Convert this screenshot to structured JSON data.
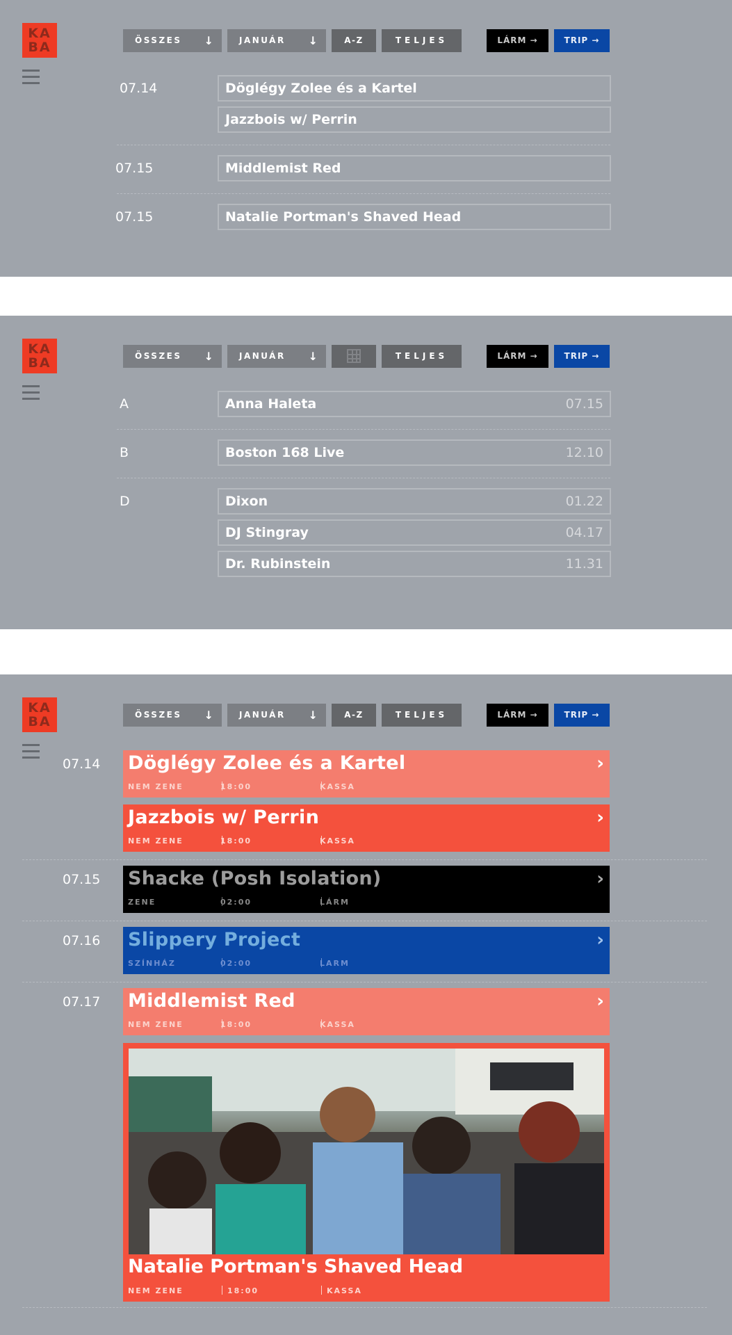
{
  "logo": {
    "line1": "KA",
    "line2": "BA"
  },
  "toolbar": {
    "filter_all": "ÖSSZES",
    "filter_month": "JANUÁR",
    "az": "A-Z",
    "full": "TELJES",
    "larm": "LÁRM →",
    "trip": "TRIP →",
    "arrow": "↓"
  },
  "panel1": {
    "groups": [
      {
        "date": "07.14",
        "events": [
          "Döglégy Zolee és a Kartel",
          "Jazzbois w/ Perrin"
        ]
      },
      {
        "date": "07.15",
        "events": [
          "Middlemist Red"
        ]
      },
      {
        "date": "07.15",
        "events": [
          "Natalie Portman's Shaved Head"
        ]
      }
    ]
  },
  "panel2": {
    "groups": [
      {
        "letter": "A",
        "events": [
          {
            "name": "Anna Haleta",
            "date": "07.15"
          }
        ]
      },
      {
        "letter": "B",
        "events": [
          {
            "name": "Boston 168 Live",
            "date": "12.10"
          }
        ]
      },
      {
        "letter": "D",
        "events": [
          {
            "name": "Dixon",
            "date": "01.22"
          },
          {
            "name": "DJ Stingray",
            "date": "04.17"
          },
          {
            "name": "Dr. Rubinstein",
            "date": "11.31"
          }
        ]
      }
    ]
  },
  "panel3": {
    "cards": [
      {
        "date": "07.14",
        "title": "Döglégy Zolee és a Kartel",
        "genre": "NEM ZENE",
        "time": "18:00",
        "venue": "KASSA",
        "color": "#f47d6e"
      },
      {
        "date": "",
        "title": "Jazzbois w/ Perrin",
        "genre": "NEM ZENE",
        "time": "18:00",
        "venue": "KASSA",
        "color": "#f4513d"
      },
      {
        "date": "07.15",
        "title": "Shacke (Posh Isolation)",
        "genre": "ZENE",
        "time": "02:00",
        "venue": "LÁRM",
        "color": "#000000"
      },
      {
        "date": "07.16",
        "title": "Slippery Project",
        "genre": "SZÍNHÁZ",
        "time": "02:00",
        "venue": "LARM",
        "color": "#0a47a5"
      },
      {
        "date": "07.17",
        "title": "Middlemist Red",
        "genre": "NEM ZENE",
        "time": "18:00",
        "venue": "KASSA",
        "color": "#f47d6e"
      }
    ],
    "photo_card": {
      "title": "Natalie Portman's Shaved Head",
      "genre": "NEM ZENE",
      "time": "18:00",
      "venue": "KASSA",
      "color": "#f4513d"
    },
    "chevron": "›"
  }
}
